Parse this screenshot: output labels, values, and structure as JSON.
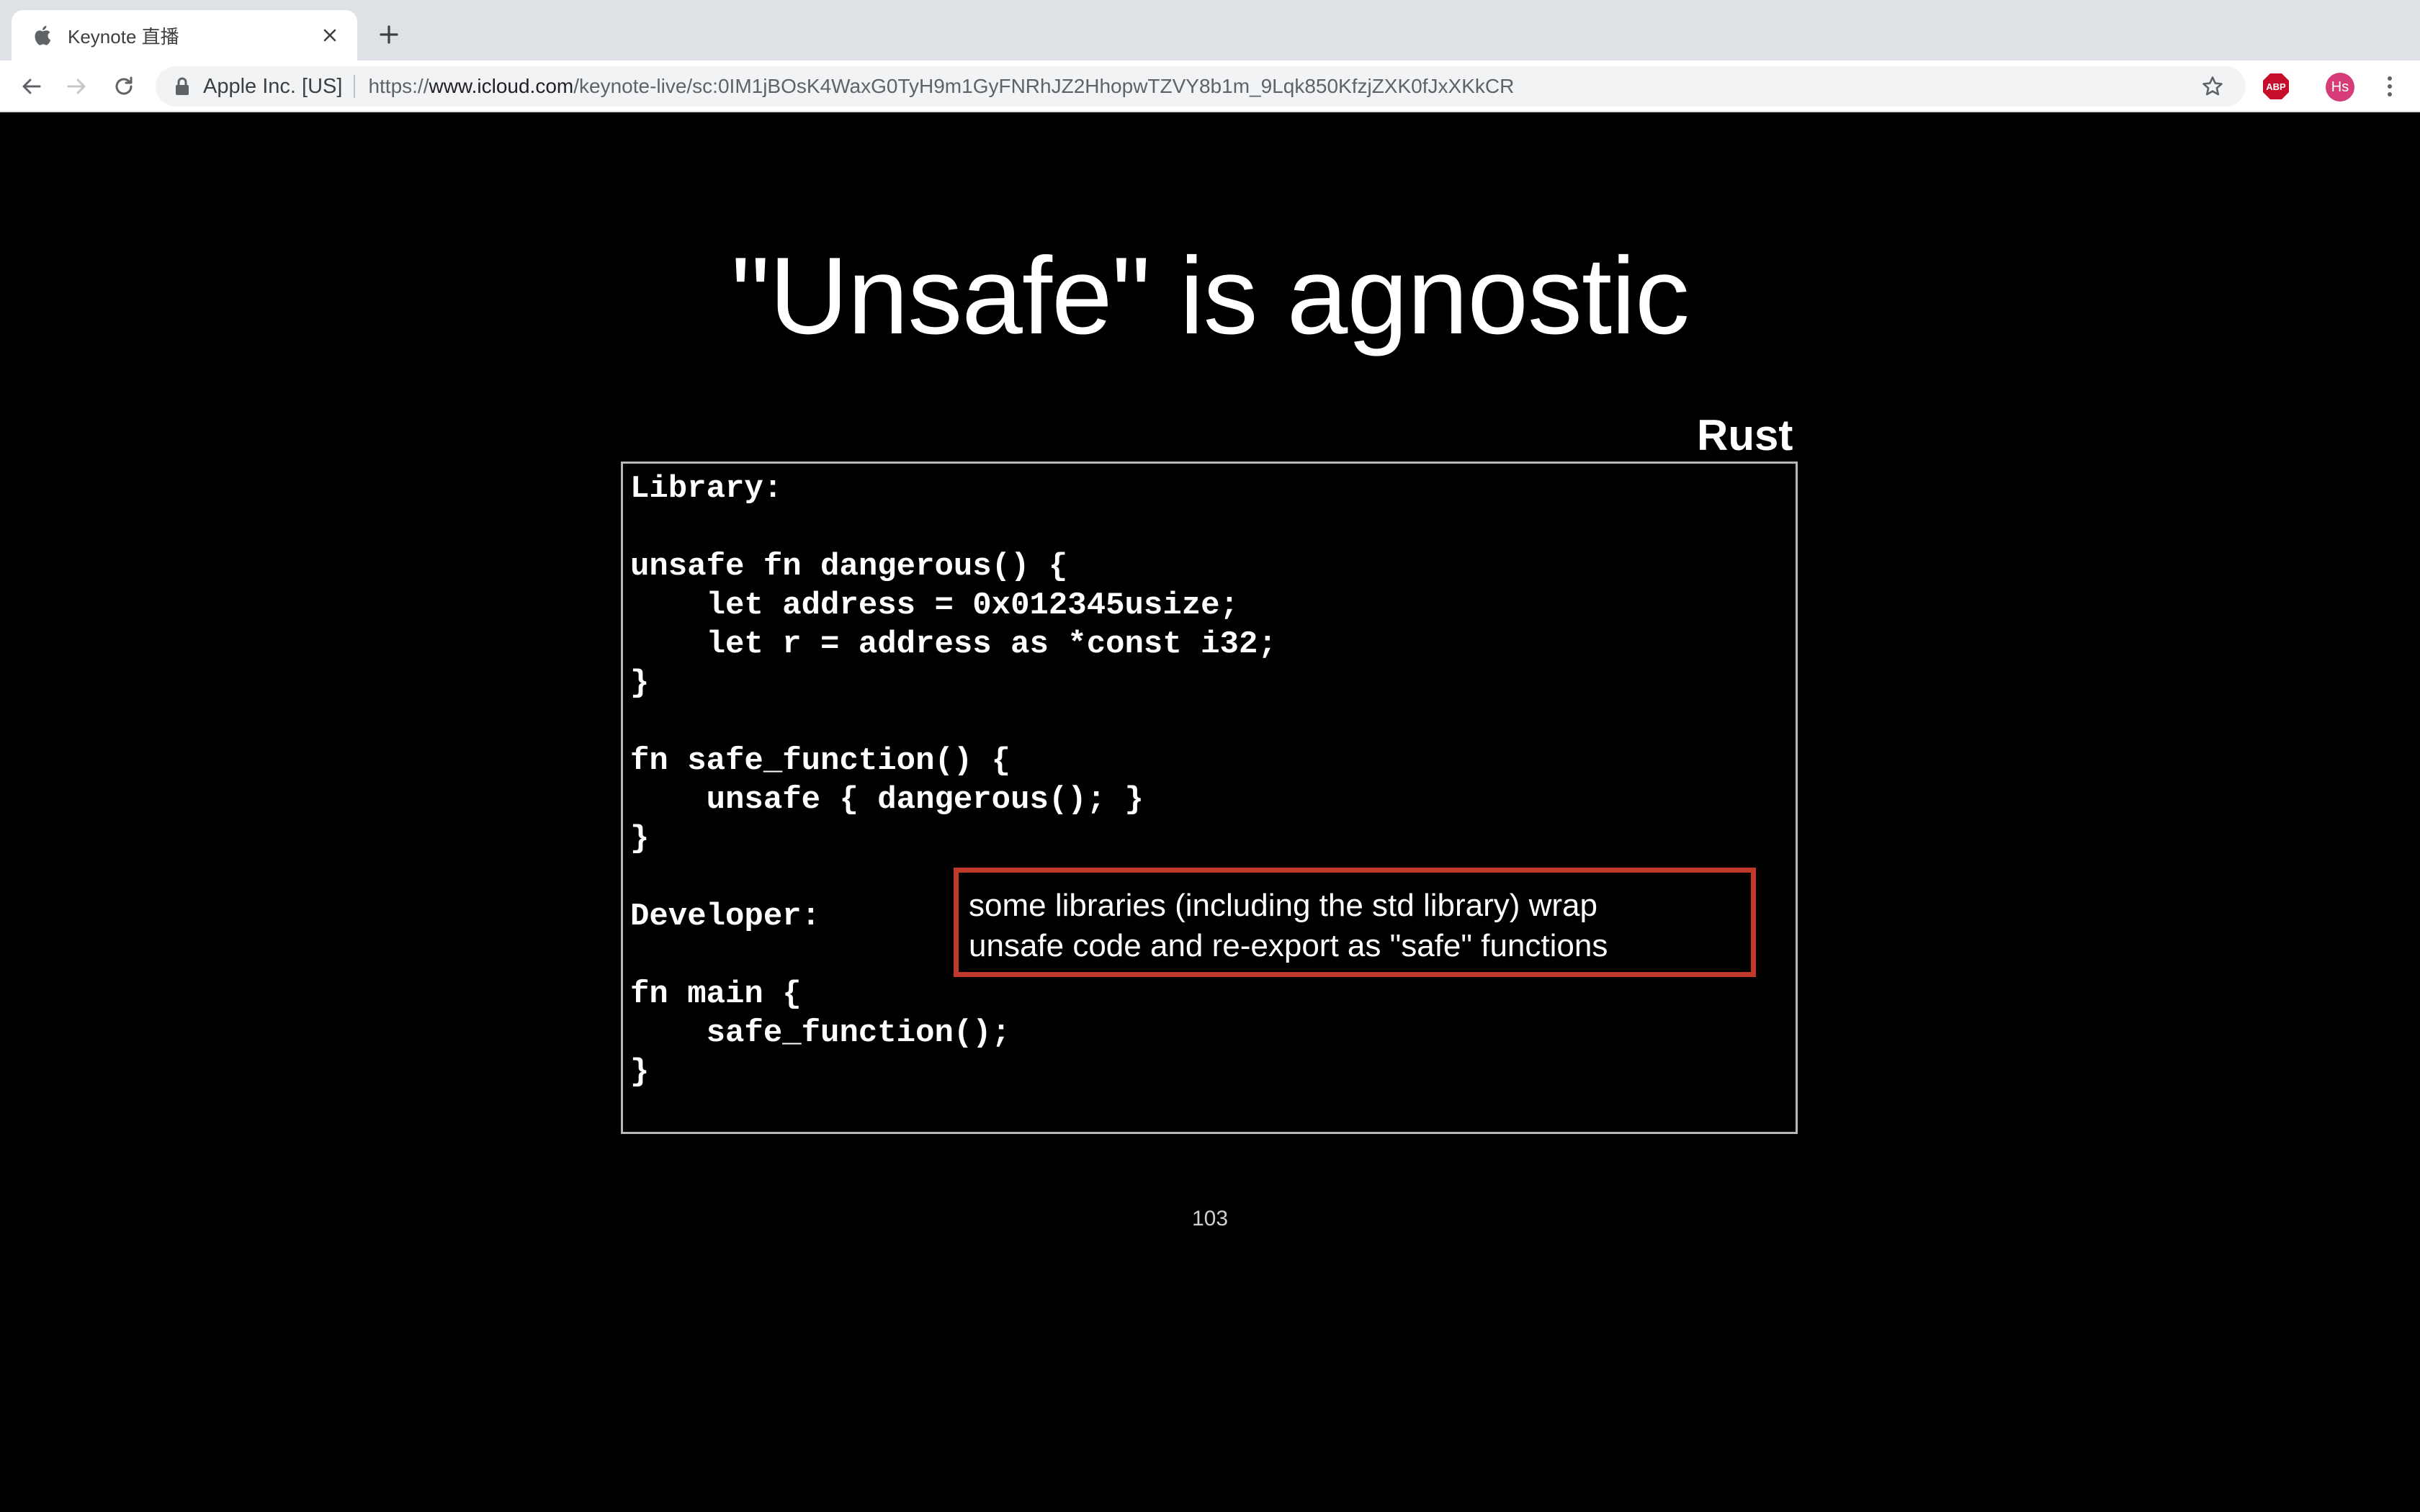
{
  "browser": {
    "tab": {
      "title": "Keynote 直播"
    },
    "omnibox": {
      "site_identity": "Apple Inc. [US]",
      "url_scheme": "https://",
      "url_host": "www.icloud.com",
      "url_path": "/keynote-live/sc:0IM1jBOsK4WaxG0TyH9m1GyFNRhJZ2HhopwTZVY8b1m_9Lqk850KfzjZXK0fJxXKkCR"
    },
    "extensions": {
      "adblock_label": "ABP"
    },
    "profile": {
      "initials": "Hs",
      "color": "#d63d78"
    }
  },
  "slide": {
    "title": "\"Unsafe\" is agnostic",
    "language_label": "Rust",
    "code_lines": [
      "Library:",
      "",
      "unsafe fn dangerous() {",
      "    let address = 0x012345usize;",
      "    let r = address as *const i32;",
      "}",
      "",
      "fn safe_function() {",
      "    unsafe { dangerous(); }",
      "}",
      "",
      "Developer:",
      "",
      "fn main {",
      "    safe_function();",
      "}"
    ],
    "callout": {
      "line1": "some libraries (including the std library) wrap",
      "line2": "unsafe code and re-export as \"safe\" functions",
      "border_color": "#c0392b"
    },
    "slide_number": "103"
  }
}
